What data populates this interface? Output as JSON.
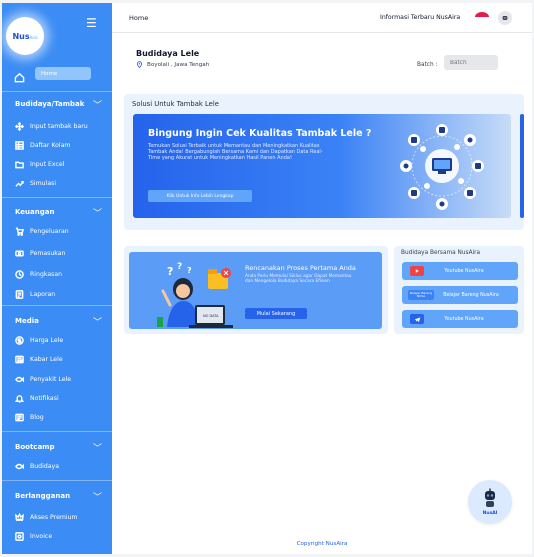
{
  "brand": {
    "logo_main": "Nus",
    "logo_small": "Aira"
  },
  "header": {
    "home": "Home",
    "info": "Informasi Terbaru NusAira"
  },
  "sidebar": {
    "home_label": "Home",
    "sections": [
      {
        "title": "Budidaya/Tambak",
        "items": [
          "Input tambak baru",
          "Daftar Kolam",
          "Input Excel",
          "Simulasi"
        ]
      },
      {
        "title": "Keuangan",
        "items": [
          "Pengeluaran",
          "Pemasukan",
          "Ringkasan",
          "Laporan"
        ]
      },
      {
        "title": "Media",
        "items": [
          "Harga Lele",
          "Kabar Lele",
          "Penyakit Lele",
          "Notifikasi",
          "Blog"
        ]
      },
      {
        "title": "Bootcamp",
        "items": [
          "Budidaya"
        ]
      },
      {
        "title": "Berlangganan",
        "items": [
          "Akses Premium",
          "Invoice"
        ]
      }
    ]
  },
  "page": {
    "title": "Budidaya Lele",
    "location": "Boyolali , Jawa Tengah",
    "batch_label": "Batch :",
    "batch_placeholder": "Batch"
  },
  "solusi": {
    "title": "Solusi Untuk Tambak Lele",
    "banner_heading": "Bingung Ingin Cek Kualitas Tambak Lele ?",
    "banner_text": "Temukan Solusi Terbaik untuk Memantau dan Meningkatkan Kualitas Tambak Anda! Bergabunglah Bersama Kami dan Dapatkan Data Real-Time yang Akurat untuk Meningkatkan Hasil Panen Anda!",
    "banner_button": "Klik Untuk Info Lebih Lengkap"
  },
  "rencanakan": {
    "heading": "Rencanakan Proses Pertama Anda",
    "text": "Anda Perlu Memulai Siklus agar Dapat Memantau dan Mengelola Budidaya Secara Efisien",
    "button": "Mulai Sekarang",
    "laptop_label": "NO DATA"
  },
  "bersama": {
    "title": "Budidaya Bersama NusAira",
    "items": [
      {
        "label": "Youtube NusAira",
        "icon": "youtube-icon",
        "color": "#ef4444"
      },
      {
        "label": "Belajar Bareng NusAira",
        "icon": "belajar-bareng-badge",
        "color": "#3b82f6",
        "badge_text": "Belajar Bareng NUSA"
      },
      {
        "label": "Youtube NusAira",
        "icon": "telegram-icon",
        "color": "#2563eb"
      }
    ]
  },
  "footer": {
    "copyright": "Copyright NusAira"
  },
  "chatbot": {
    "label": "NusAI"
  },
  "colors": {
    "sidebar": "#3b8cf5",
    "accent": "#2563eb",
    "card_bg": "#eaf2fe"
  }
}
